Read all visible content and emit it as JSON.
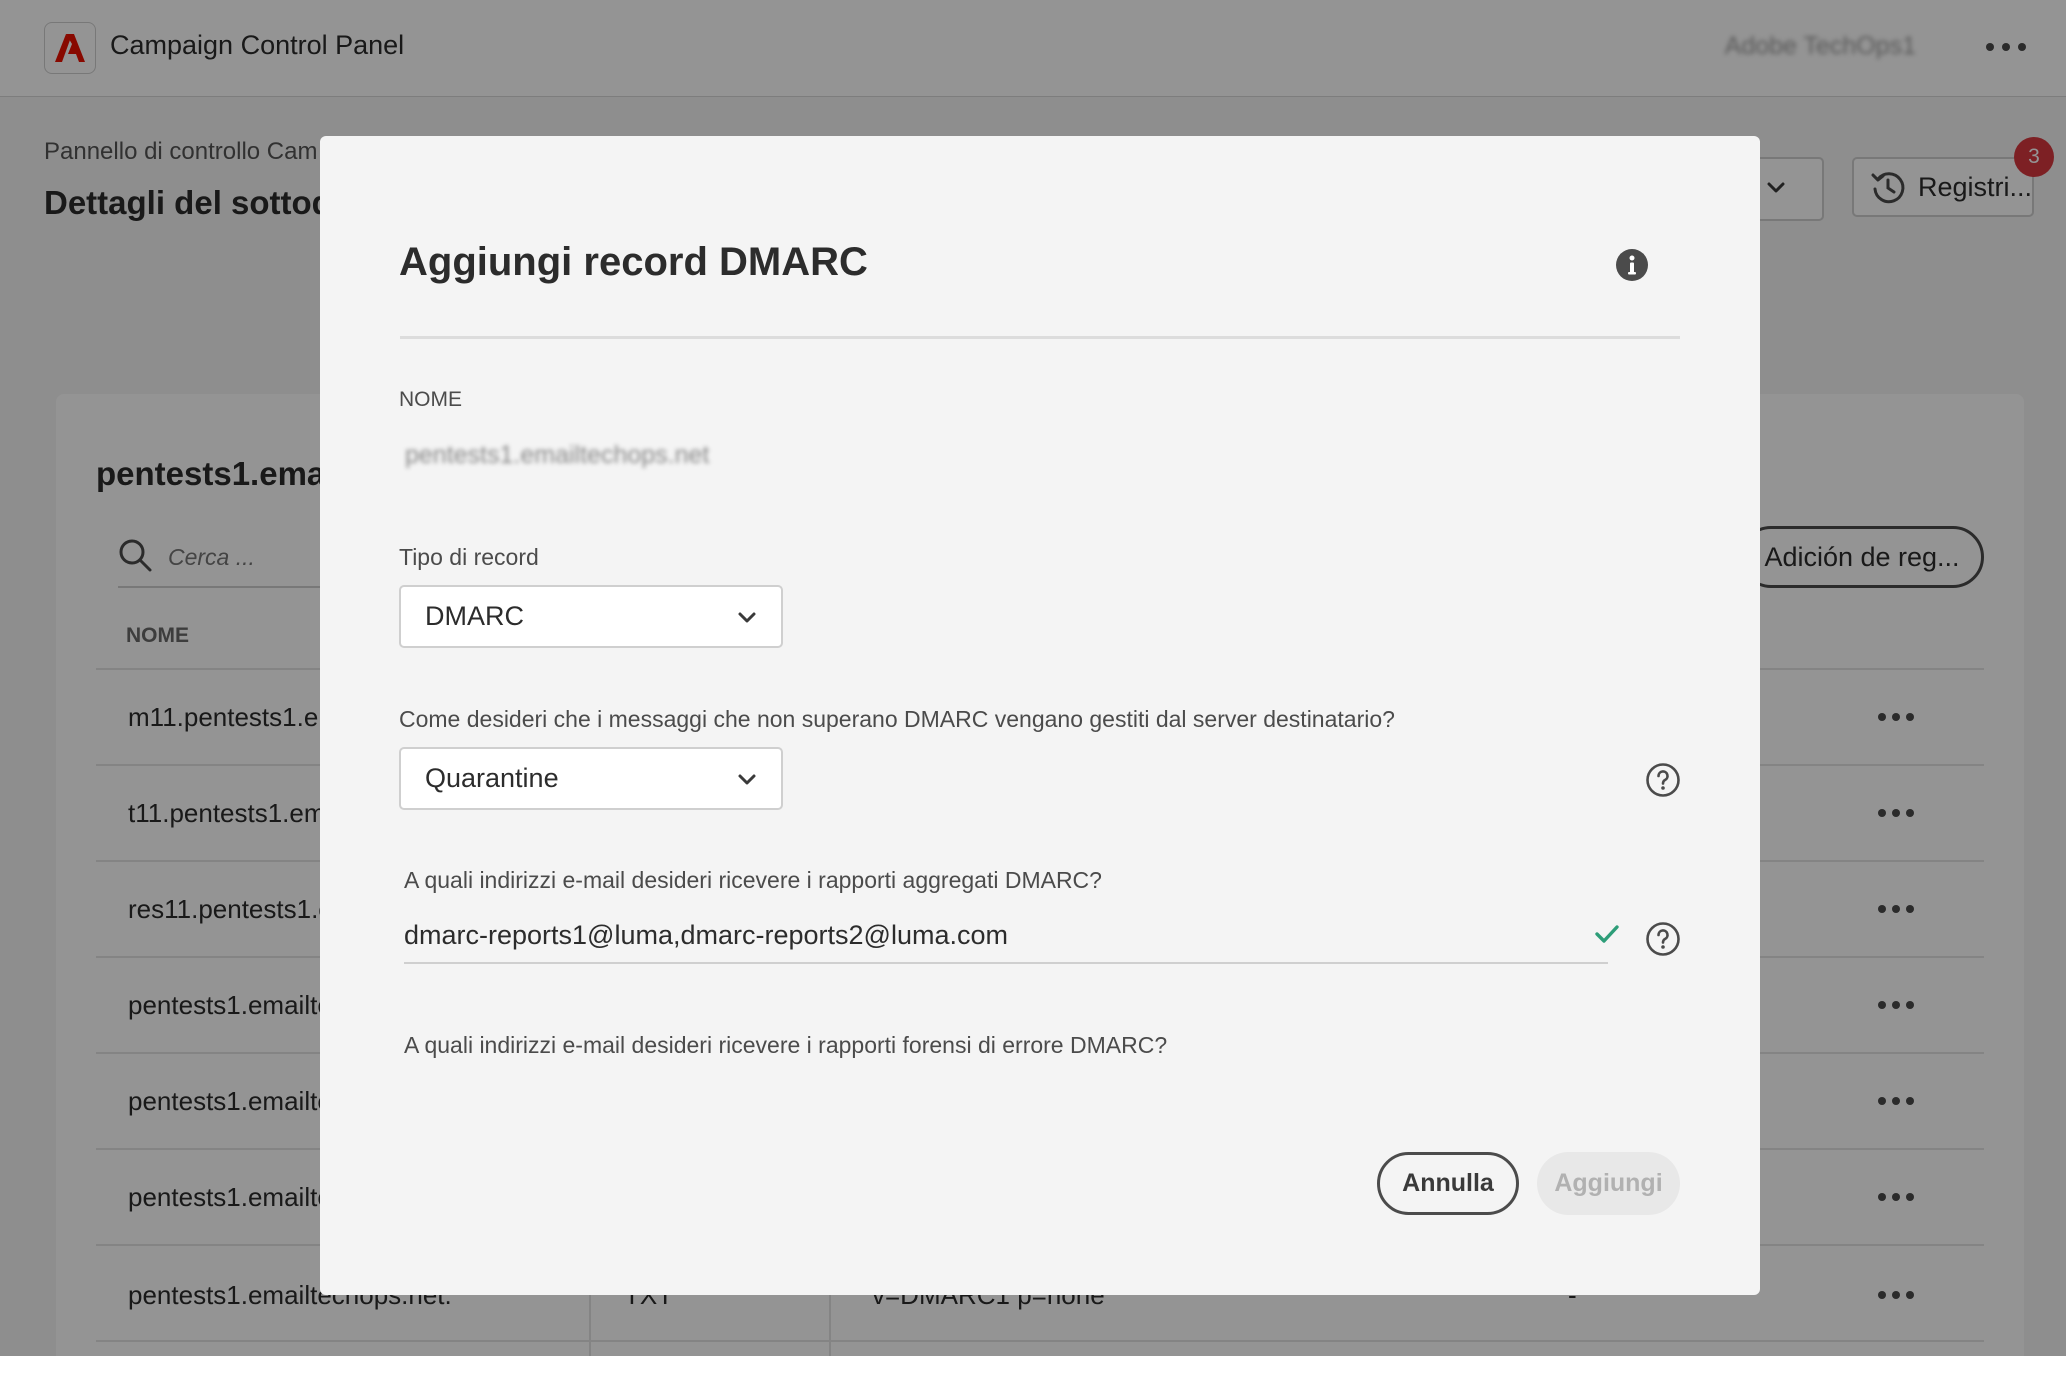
{
  "app": {
    "title": "Campaign Control Panel",
    "org_name": "Adobe TechOps1",
    "brand_color": "#eb1000"
  },
  "page": {
    "breadcrumb": "Pannello di controllo Cam",
    "title": "Dettagli del sottod",
    "logs_label": "Registri...",
    "notification_count": "3"
  },
  "card": {
    "title": "pentests1.emai",
    "search_placeholder": "Cerca ...",
    "add_record_label": "Adición de reg...",
    "column_name": "NOME",
    "rows": [
      {
        "name": "m11.pentests1.em"
      },
      {
        "name": "t11.pentests1.ema"
      },
      {
        "name": "res11.pentests1.en"
      },
      {
        "name": "pentests1.emailte"
      },
      {
        "name": "pentests1.emailte"
      },
      {
        "name": "pentests1.emailte"
      },
      {
        "name": "pentests1.emailtechops.net.",
        "type": "TXT",
        "value": "v=DMARC1 p=none",
        "extra": "-"
      }
    ]
  },
  "dialog": {
    "title": "Aggiungi record DMARC",
    "name_label": "NOME",
    "name_value": "pentests1.emailtechops.net",
    "record_type_label": "Tipo di record",
    "record_type_value": "DMARC",
    "policy_question": "Come desideri che i messaggi che non superano DMARC vengano gestiti dal server destinatario?",
    "policy_value": "Quarantine",
    "aggregate_question": "A quali indirizzi e-mail desideri ricevere i rapporti aggregati DMARC?",
    "aggregate_value": "dmarc-reports1@luma,dmarc-reports2@luma.com",
    "forensic_question": "A quali indirizzi e-mail desideri ricevere i rapporti forensi di errore DMARC?",
    "cancel_label": "Annulla",
    "add_label": "Aggiungi",
    "valid_color": "#2d9d78"
  }
}
